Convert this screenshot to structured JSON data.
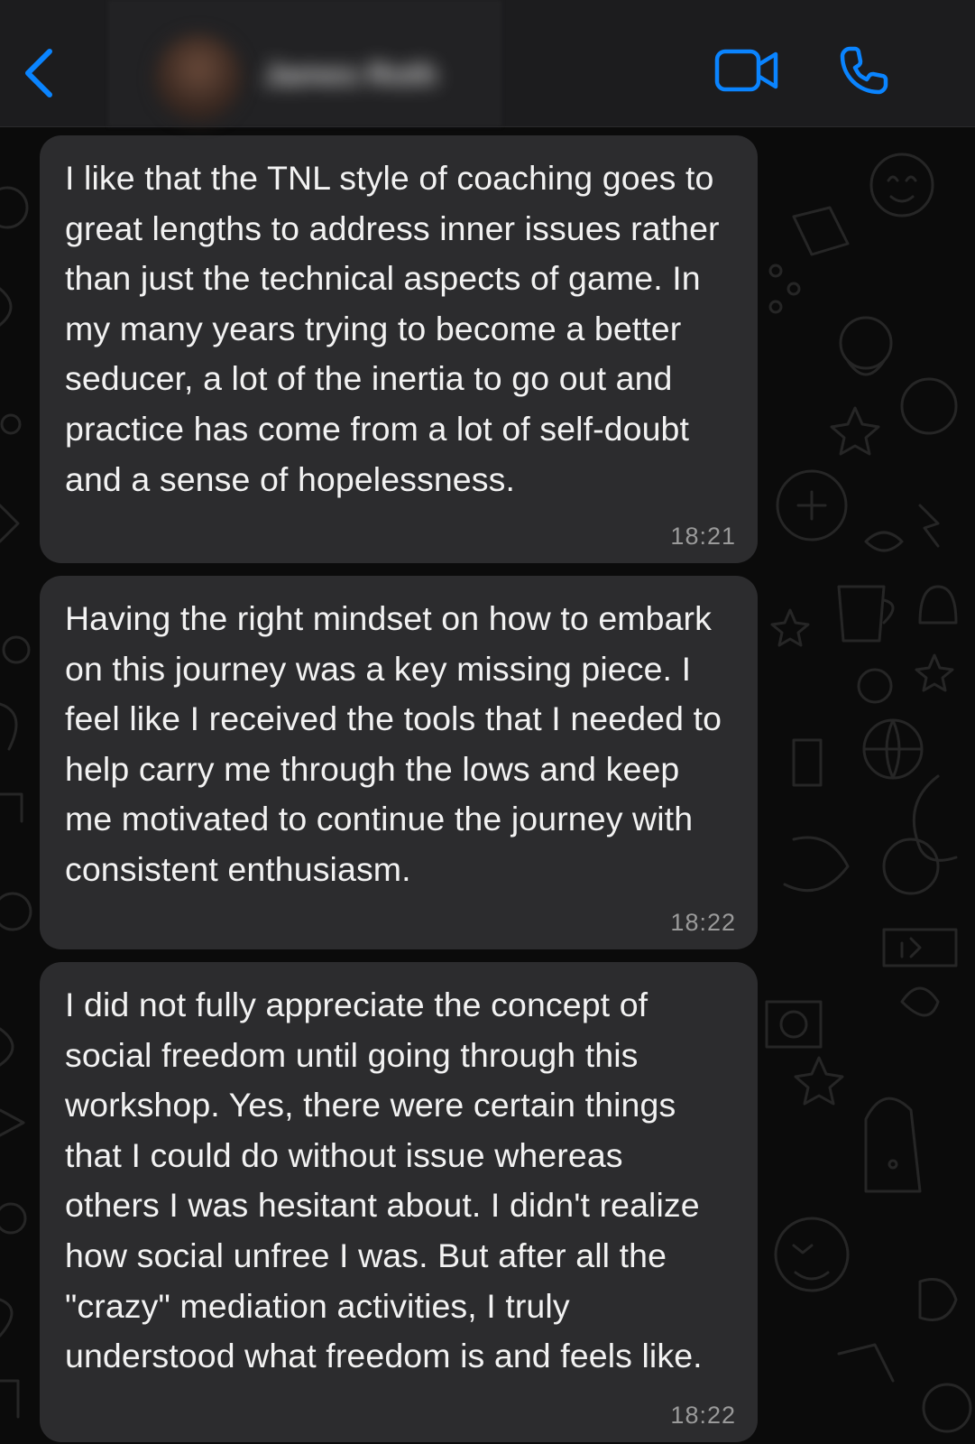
{
  "header": {
    "contact_name": "James Roth",
    "accent_color": "#0a84ff"
  },
  "icons": {
    "back": "chevron-left-icon",
    "video": "video-camera-icon",
    "call": "phone-icon"
  },
  "messages": [
    {
      "text": "I like that the TNL style of coaching goes to great lengths to address inner issues rather than just the technical aspects of game. In my many years trying to become a better seducer, a lot of the inertia to go out and practice has come from a lot of self-doubt and a sense of hopelessness.",
      "time": "18:21"
    },
    {
      "text": "Having the right mindset on how to embark on this journey was a key missing piece. I feel like I received the tools that I needed to help carry me through the lows and keep me motivated to continue the journey with consistent enthusiasm.",
      "time": "18:22"
    },
    {
      "text": "I did not fully appreciate the concept of social freedom until going through this workshop. Yes, there were certain things that I could do without issue whereas others I was hesitant about. I didn't realize how social unfree I was. But after all the \"crazy\" mediation activities, I truly understood what freedom is and feels like.",
      "time": "18:22"
    }
  ],
  "colors": {
    "header_bg": "#1c1c1e",
    "bubble_bg": "#2c2c2e",
    "chat_bg": "#0b0b0b",
    "text": "#f2f2f2",
    "timestamp": "#9a9a9a"
  }
}
